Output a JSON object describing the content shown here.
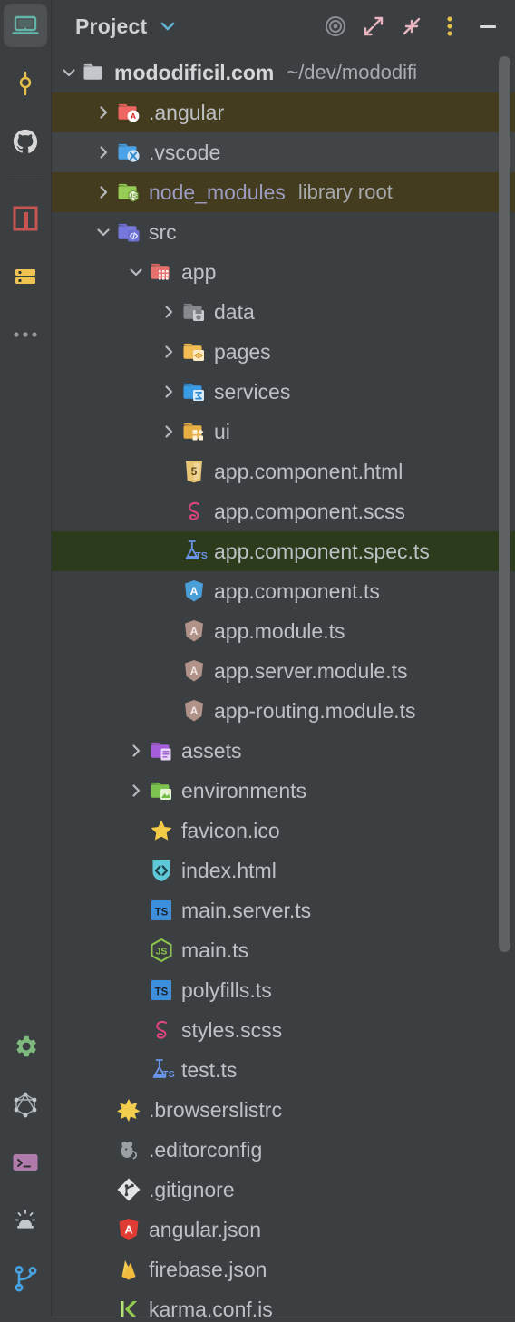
{
  "activity_bar": {
    "top_items": [
      {
        "name": "project-view-icon",
        "label": "Project",
        "color": "#62b5a9",
        "selected": true
      },
      {
        "name": "commit-icon",
        "label": "Commit",
        "color": "#e8c14a",
        "selected": false
      },
      {
        "name": "github-icon",
        "label": "GitHub",
        "color": "#d8d8d8",
        "selected": false
      }
    ],
    "mid_items": [
      {
        "name": "nx-console-icon",
        "label": "Nx Console",
        "color": "#c75450",
        "selected": false
      },
      {
        "name": "database-icon",
        "label": "Database",
        "color": "#f0c251",
        "selected": false
      },
      {
        "name": "more-tool-windows-icon",
        "label": "More Tool Windows",
        "color": "#9a9ea1",
        "selected": false
      }
    ],
    "bottom_items": [
      {
        "name": "settings-gear-icon",
        "label": "Settings",
        "color": "#7eb97e",
        "selected": false
      },
      {
        "name": "graphql-icon",
        "label": "GraphQL",
        "color": "#aab0b4",
        "selected": false
      },
      {
        "name": "terminal-icon",
        "label": "Terminal",
        "color": "#b07aab",
        "selected": false
      },
      {
        "name": "problems-alert-icon",
        "label": "Problems",
        "color": "#c3c8cc",
        "selected": false
      },
      {
        "name": "git-branch-icon",
        "label": "Git",
        "color": "#46a2e0",
        "selected": false
      }
    ]
  },
  "header": {
    "title": "Project",
    "dropdown_icon": "chevron-down-icon",
    "buttons": [
      {
        "name": "select-opened-file-button",
        "label": "Select Opened File",
        "icon": "target-icon",
        "color": "#8b8f93"
      },
      {
        "name": "expand-all-button",
        "label": "Expand All",
        "icon": "expand-arrows-icon",
        "color": "#e8b4c0"
      },
      {
        "name": "collapse-all-button",
        "label": "Collapse All",
        "icon": "collapse-arrows-icon",
        "color": "#e8b4c0"
      },
      {
        "name": "options-menu-button",
        "label": "Options",
        "icon": "vertical-dots-icon",
        "color": "#e8c14a"
      },
      {
        "name": "hide-panel-button",
        "label": "Hide",
        "icon": "minimize-icon",
        "color": "#d8dbde"
      }
    ]
  },
  "tree": {
    "rows": [
      {
        "label": "mododificil.com",
        "annot": "~/dev/mododifi",
        "icon": "folder-plain-icon",
        "state": "expanded",
        "indent": 0,
        "kind": "root",
        "highlight": "none"
      },
      {
        "label": ".angular",
        "annot": "",
        "icon": "folder-angular-icon",
        "state": "collapsed",
        "indent": 1,
        "kind": "folder",
        "highlight": "ignored"
      },
      {
        "label": ".vscode",
        "annot": "",
        "icon": "folder-vscode-icon",
        "state": "collapsed",
        "indent": 1,
        "kind": "folder",
        "highlight": "hover"
      },
      {
        "label": "node_modules",
        "annot": "library root",
        "icon": "folder-node-icon",
        "state": "collapsed",
        "indent": 1,
        "kind": "folder",
        "highlight": "ignored",
        "label_style": "dim-violet"
      },
      {
        "label": "src",
        "annot": "",
        "icon": "folder-source-icon",
        "state": "expanded",
        "indent": 1,
        "kind": "folder",
        "highlight": "none"
      },
      {
        "label": "app",
        "annot": "",
        "icon": "folder-app-icon",
        "state": "expanded",
        "indent": 2,
        "kind": "folder",
        "highlight": "none"
      },
      {
        "label": "data",
        "annot": "",
        "icon": "folder-data-icon",
        "state": "collapsed",
        "indent": 3,
        "kind": "folder",
        "highlight": "none"
      },
      {
        "label": "pages",
        "annot": "",
        "icon": "folder-pages-icon",
        "state": "collapsed",
        "indent": 3,
        "kind": "folder",
        "highlight": "none"
      },
      {
        "label": "services",
        "annot": "",
        "icon": "folder-services-icon",
        "state": "collapsed",
        "indent": 3,
        "kind": "folder",
        "highlight": "none"
      },
      {
        "label": "ui",
        "annot": "",
        "icon": "folder-ui-icon",
        "state": "collapsed",
        "indent": 3,
        "kind": "folder",
        "highlight": "none"
      },
      {
        "label": "app.component.html",
        "annot": "",
        "icon": "file-html5-icon",
        "state": "leaf",
        "indent": 3,
        "kind": "file",
        "highlight": "none"
      },
      {
        "label": "app.component.scss",
        "annot": "",
        "icon": "file-sass-icon",
        "state": "leaf",
        "indent": 3,
        "kind": "file",
        "highlight": "none"
      },
      {
        "label": "app.component.spec.ts",
        "annot": "",
        "icon": "file-spec-ts-icon",
        "state": "leaf",
        "indent": 3,
        "kind": "file",
        "highlight": "selected"
      },
      {
        "label": "app.component.ts",
        "annot": "",
        "icon": "file-angular-component-icon",
        "state": "leaf",
        "indent": 3,
        "kind": "file",
        "highlight": "none"
      },
      {
        "label": "app.module.ts",
        "annot": "",
        "icon": "file-angular-module-icon",
        "state": "leaf",
        "indent": 3,
        "kind": "file",
        "highlight": "none"
      },
      {
        "label": "app.server.module.ts",
        "annot": "",
        "icon": "file-angular-module-icon",
        "state": "leaf",
        "indent": 3,
        "kind": "file",
        "highlight": "none"
      },
      {
        "label": "app-routing.module.ts",
        "annot": "",
        "icon": "file-angular-module-icon",
        "state": "leaf",
        "indent": 3,
        "kind": "file",
        "highlight": "none"
      },
      {
        "label": "assets",
        "annot": "",
        "icon": "folder-assets-icon",
        "state": "collapsed",
        "indent": 2,
        "kind": "folder",
        "highlight": "none"
      },
      {
        "label": "environments",
        "annot": "",
        "icon": "folder-environments-icon",
        "state": "collapsed",
        "indent": 2,
        "kind": "folder",
        "highlight": "none"
      },
      {
        "label": "favicon.ico",
        "annot": "",
        "icon": "file-favicon-icon",
        "state": "leaf",
        "indent": 2,
        "kind": "file",
        "highlight": "none"
      },
      {
        "label": "index.html",
        "annot": "",
        "icon": "file-index-html-icon",
        "state": "leaf",
        "indent": 2,
        "kind": "file",
        "highlight": "none"
      },
      {
        "label": "main.server.ts",
        "annot": "",
        "icon": "file-typescript-icon",
        "state": "leaf",
        "indent": 2,
        "kind": "file",
        "highlight": "none"
      },
      {
        "label": "main.ts",
        "annot": "",
        "icon": "file-node-icon",
        "state": "leaf",
        "indent": 2,
        "kind": "file",
        "highlight": "none"
      },
      {
        "label": "polyfills.ts",
        "annot": "",
        "icon": "file-typescript-icon",
        "state": "leaf",
        "indent": 2,
        "kind": "file",
        "highlight": "none"
      },
      {
        "label": "styles.scss",
        "annot": "",
        "icon": "file-sass-icon",
        "state": "leaf",
        "indent": 2,
        "kind": "file",
        "highlight": "none"
      },
      {
        "label": "test.ts",
        "annot": "",
        "icon": "file-spec-ts-icon",
        "state": "leaf",
        "indent": 2,
        "kind": "file",
        "highlight": "none"
      },
      {
        "label": ".browserslistrc",
        "annot": "",
        "icon": "file-browserslist-icon",
        "state": "leaf",
        "indent": 1,
        "kind": "file",
        "highlight": "none"
      },
      {
        "label": ".editorconfig",
        "annot": "",
        "icon": "file-editorconfig-icon",
        "state": "leaf",
        "indent": 1,
        "kind": "file",
        "highlight": "none"
      },
      {
        "label": ".gitignore",
        "annot": "",
        "icon": "file-gitignore-icon",
        "state": "leaf",
        "indent": 1,
        "kind": "file",
        "highlight": "none"
      },
      {
        "label": "angular.json",
        "annot": "",
        "icon": "file-angular-json-icon",
        "state": "leaf",
        "indent": 1,
        "kind": "file",
        "highlight": "none"
      },
      {
        "label": "firebase.json",
        "annot": "",
        "icon": "file-firebase-icon",
        "state": "leaf",
        "indent": 1,
        "kind": "file",
        "highlight": "none"
      },
      {
        "label": "karma.conf.js",
        "annot": "",
        "icon": "file-karma-icon",
        "state": "leaf",
        "indent": 1,
        "kind": "file",
        "highlight": "none"
      }
    ]
  },
  "scrollbar": {
    "name": "vertical-scrollbar",
    "visible": true
  },
  "colors": {
    "panel_bg": "#3c3f41",
    "ignored_row": "#433c1e",
    "selected_row": "#2c3b1c",
    "hover_row": "#414548",
    "text": "#bdc0c4",
    "accent_cyan": "#62b5d4"
  }
}
